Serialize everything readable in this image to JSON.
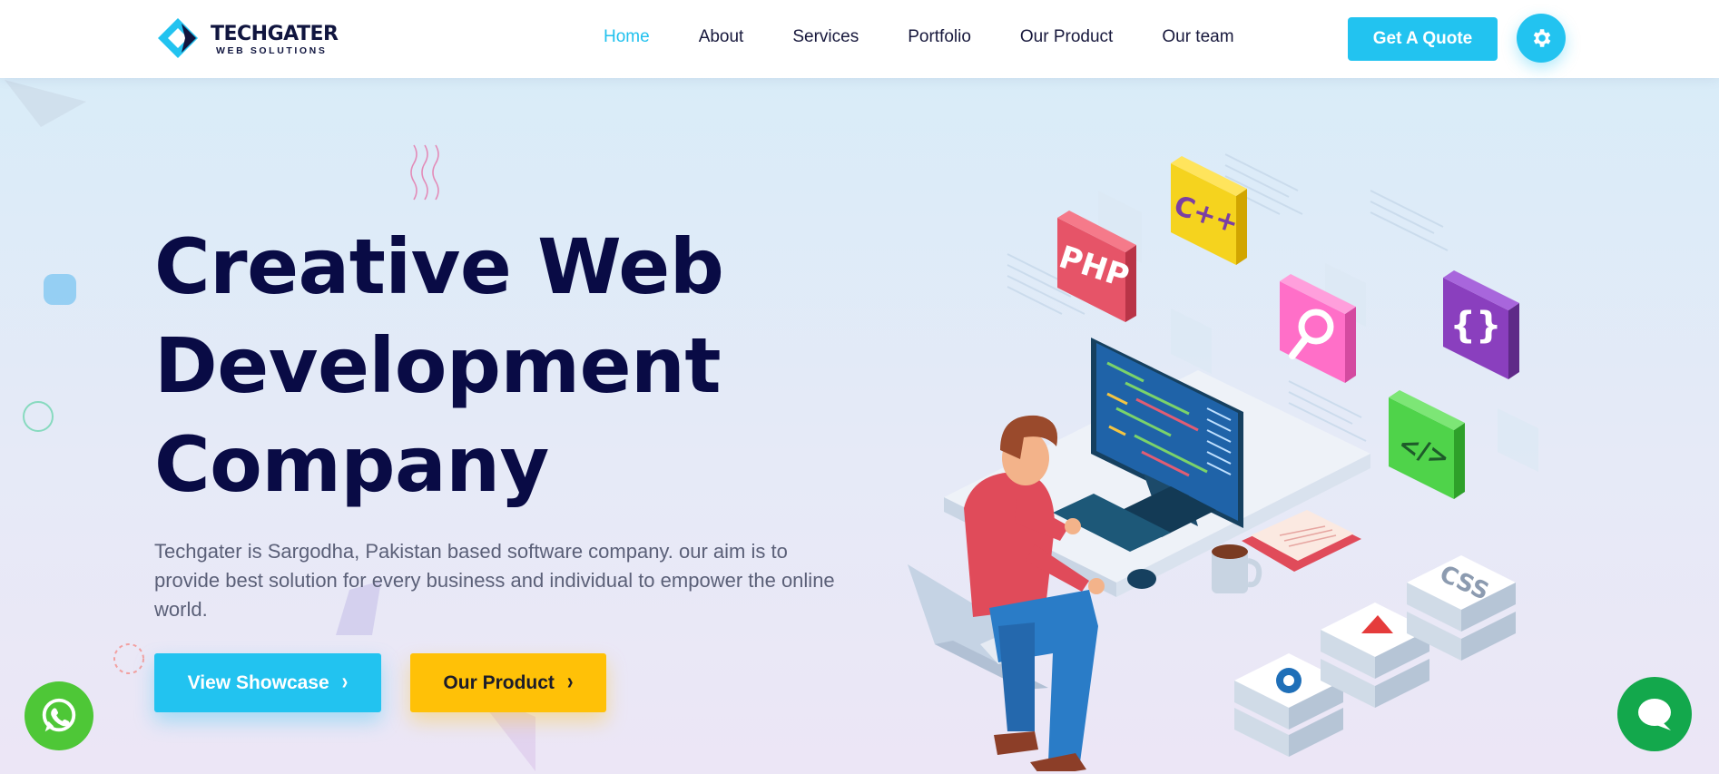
{
  "brand": {
    "name": "TECHGATER",
    "tagline": "WEB SOLUTIONS",
    "accent": "#22c3f0",
    "secondary": "#ffc107",
    "dark": "#090b45"
  },
  "nav": {
    "items": [
      {
        "label": "Home",
        "active": true
      },
      {
        "label": "About",
        "active": false
      },
      {
        "label": "Services",
        "active": false
      },
      {
        "label": "Portfolio",
        "active": false
      },
      {
        "label": "Our Product",
        "active": false
      },
      {
        "label": "Our team",
        "active": false
      }
    ],
    "cta_label": "Get A Quote",
    "settings_icon": "gear-icon"
  },
  "hero": {
    "title_lines": [
      "Creative Web",
      "Development",
      "Company"
    ],
    "description": "Techgater is Sargodha, Pakistan based software company. our aim is to provide best solution for every business and individual to empower the online world.",
    "primary_button": "View Showcase",
    "secondary_button": "Our Product"
  },
  "illustration": {
    "tiles": [
      "PHP",
      "C++",
      "{}",
      "</>",
      "CSS"
    ]
  },
  "floating": {
    "whatsapp_icon": "whatsapp-icon",
    "chat_icon": "chat-bubble-icon"
  }
}
